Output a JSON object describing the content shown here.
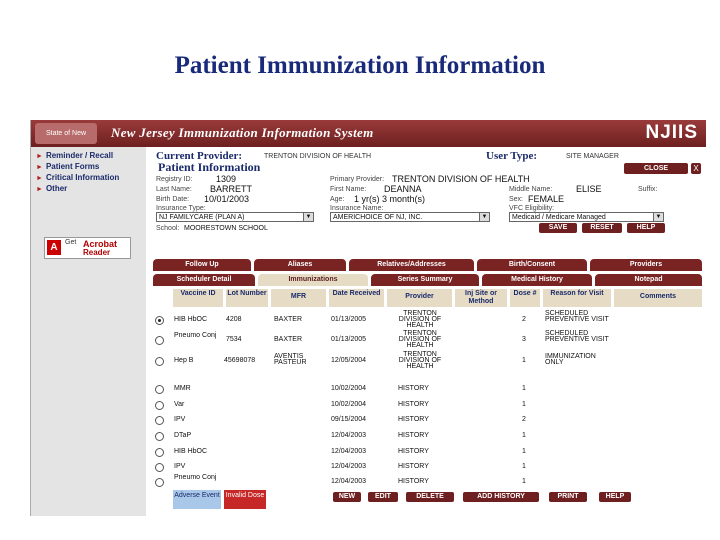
{
  "slide_title": "Patient Immunization Information",
  "app": {
    "system_title": "New Jersey Immunization Information System",
    "logo_text": "NJIIS",
    "left_logo_text": "State of New Jersey"
  },
  "nav": {
    "items": [
      "Reminder / Recall",
      "Patient Forms",
      "Critical Information",
      "Other"
    ],
    "acrobat": {
      "get": "Get",
      "line1": "Acrobat",
      "line2": "Reader",
      "brand": "Adobe"
    }
  },
  "header": {
    "current_provider_label": "Current Provider:",
    "current_provider_value": "TRENTON DIVISION OF HEALTH",
    "user_type_label": "User Type:",
    "user_type_value": "SITE MANAGER",
    "section_title": "Patient Information",
    "close_label": "CLOSE",
    "close_x": "X"
  },
  "patient": {
    "registry_id_label": "Registry ID:",
    "registry_id": "1309",
    "primary_provider_label": "Primary Provider:",
    "primary_provider": "TRENTON DIVISION OF HEALTH",
    "last_name_label": "Last Name:",
    "last_name": "BARRETT",
    "first_name_label": "First Name:",
    "first_name": "DEANNA",
    "middle_name_label": "Middle Name:",
    "middle_name": "ELISE",
    "suffix_label": "Suffix:",
    "birth_date_label": "Birth Date:",
    "birth_date": "10/01/2003",
    "age_label": "Age:",
    "age": "1 yr(s) 3 month(s)",
    "sex_label": "Sex:",
    "sex": "FEMALE",
    "insurance_type_label": "Insurance Type:",
    "insurance_type": "NJ FAMILYCARE (PLAN A)",
    "insurance_name_label": "Insurance Name:",
    "insurance_name": "AMERICHOICE OF NJ, INC.",
    "vfc_label": "VFC Eligibility:",
    "vfc": "Medicaid / Medicare Managed",
    "school_label": "School:",
    "school": "MOORESTOWN SCHOOL",
    "save_label": "SAVE",
    "reset_label": "RESET",
    "help_label": "HELP"
  },
  "tabs_row1": [
    "Follow Up",
    "Aliases",
    "Relatives/Addresses",
    "Birth/Consent",
    "Providers"
  ],
  "tabs_row2": [
    "Scheduler Detail",
    "Immunizations",
    "Series Summary",
    "Medical History",
    "Notepad"
  ],
  "active_tab": "Immunizations",
  "columns": [
    "Vaccine ID",
    "Lot Number",
    "MFR",
    "Date Received",
    "Provider",
    "Inj Site or Method",
    "Dose #",
    "Reason for Visit",
    "Comments"
  ],
  "rows": [
    {
      "selected": true,
      "vaccine": "HIB HbOC",
      "lot": "4208",
      "mfr": "BAXTER",
      "date": "01/13/2005",
      "provider": "TRENTON DIVISION OF HEALTH",
      "method": "",
      "dose": "2",
      "reason": "SCHEDULED PREVENTIVE VISIT"
    },
    {
      "selected": false,
      "vaccine": "Pneumo Conj",
      "lot": "7534",
      "mfr": "BAXTER",
      "date": "01/13/2005",
      "provider": "TRENTON DIVISION OF HEALTH",
      "method": "",
      "dose": "3",
      "reason": "SCHEDULED PREVENTIVE VISIT"
    },
    {
      "selected": false,
      "vaccine": "Hep B",
      "lot": "45698078",
      "mfr": "AVENTIS PASTEUR",
      "date": "12/05/2004",
      "provider": "TRENTON DIVISION OF HEALTH",
      "method": "",
      "dose": "1",
      "reason": "IMMUNIZATION ONLY"
    },
    {
      "selected": false,
      "vaccine": "MMR",
      "lot": "",
      "mfr": "",
      "date": "10/02/2004",
      "provider": "HISTORY",
      "method": "",
      "dose": "1",
      "reason": ""
    },
    {
      "selected": false,
      "vaccine": "Var",
      "lot": "",
      "mfr": "",
      "date": "10/02/2004",
      "provider": "HISTORY",
      "method": "",
      "dose": "1",
      "reason": ""
    },
    {
      "selected": false,
      "vaccine": "IPV",
      "lot": "",
      "mfr": "",
      "date": "09/15/2004",
      "provider": "HISTORY",
      "method": "",
      "dose": "2",
      "reason": ""
    },
    {
      "selected": false,
      "vaccine": "DTaP",
      "lot": "",
      "mfr": "",
      "date": "12/04/2003",
      "provider": "HISTORY",
      "method": "",
      "dose": "1",
      "reason": ""
    },
    {
      "selected": false,
      "vaccine": "HIB HbOC",
      "lot": "",
      "mfr": "",
      "date": "12/04/2003",
      "provider": "HISTORY",
      "method": "",
      "dose": "1",
      "reason": ""
    },
    {
      "selected": false,
      "vaccine": "IPV",
      "lot": "",
      "mfr": "",
      "date": "12/04/2003",
      "provider": "HISTORY",
      "method": "",
      "dose": "1",
      "reason": ""
    },
    {
      "selected": false,
      "vaccine": "Pneumo Conj",
      "lot": "",
      "mfr": "",
      "date": "12/04/2003",
      "provider": "HISTORY",
      "method": "",
      "dose": "1",
      "reason": ""
    }
  ],
  "legend": {
    "adverse": "Adverse Event",
    "invalid": "Invalid Dose"
  },
  "actions": {
    "new": "NEW",
    "edit": "EDIT",
    "delete": "DELETE",
    "add_history": "ADD HISTORY",
    "print": "PRINT",
    "help": "HELP"
  },
  "colors": {
    "header_bg": "#6e1f1f",
    "accent_blue": "#1a2a6a",
    "grid_header": "#e6dcc6",
    "adverse": "#a9c7e8",
    "invalid": "#c62828"
  }
}
